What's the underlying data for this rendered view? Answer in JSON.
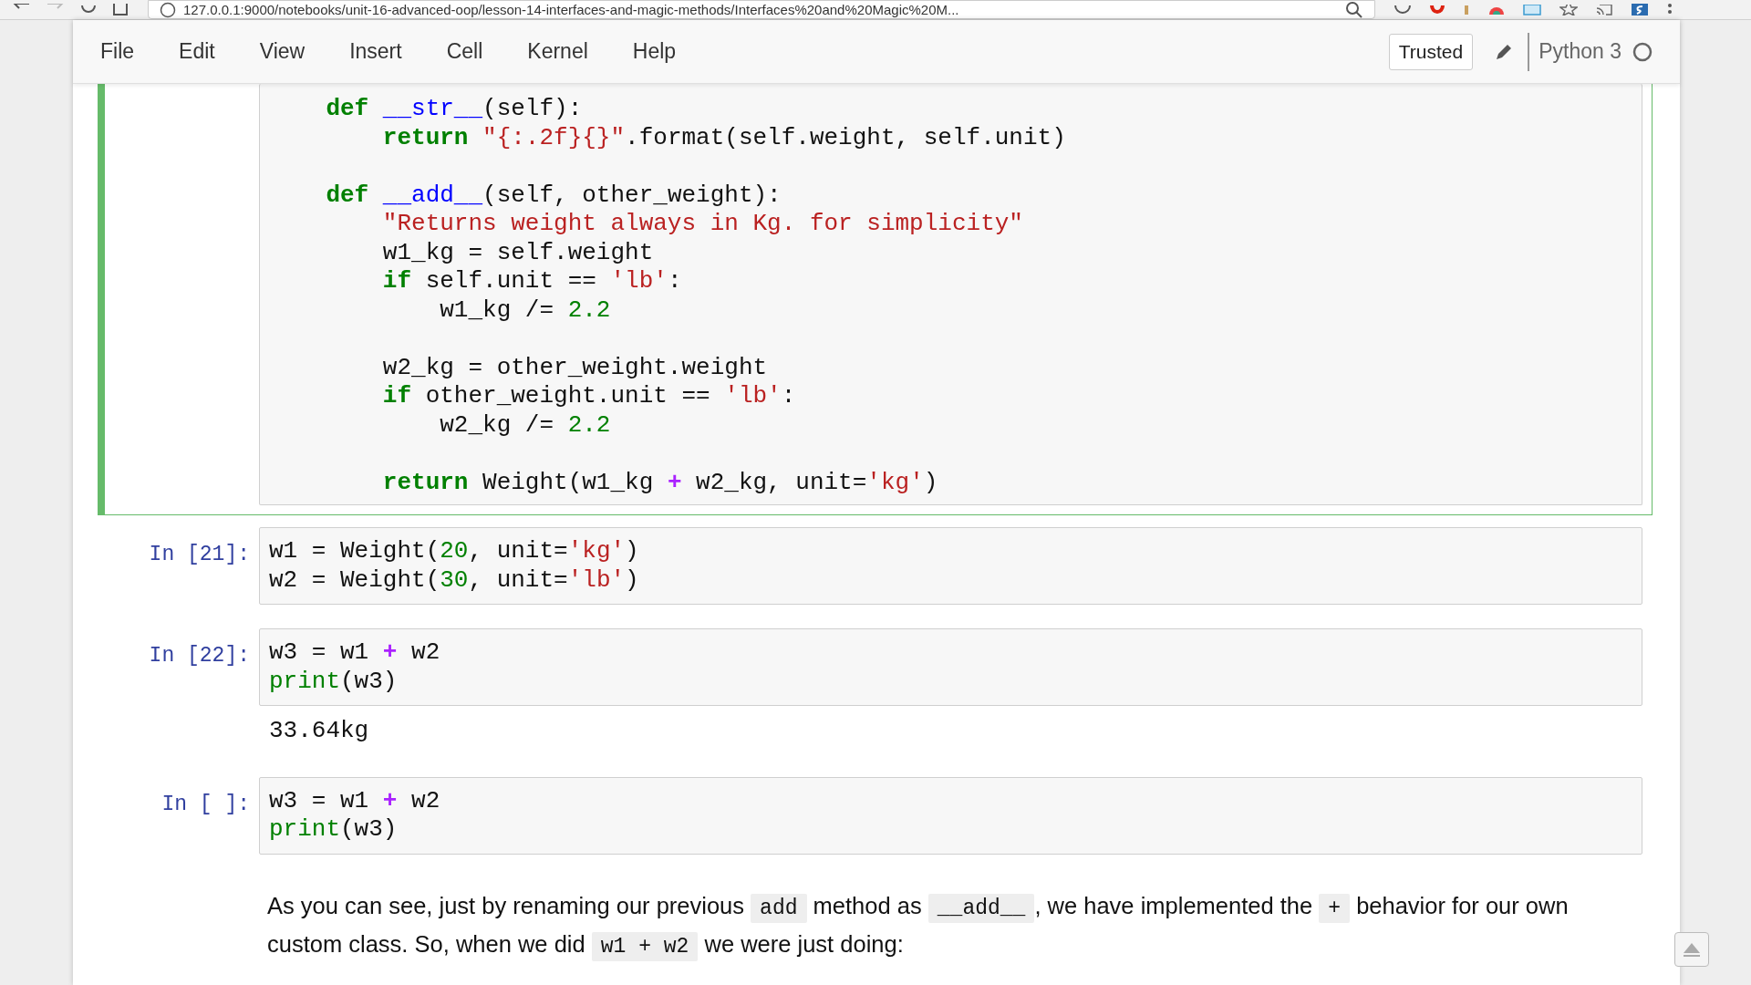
{
  "browser": {
    "url": "127.0.0.1:9000/notebooks/unit-16-advanced-oop/lesson-14-interfaces-and-magic-methods/Interfaces%20and%20Magic%20M..."
  },
  "menu": [
    "File",
    "Edit",
    "View",
    "Insert",
    "Cell",
    "Kernel",
    "Help"
  ],
  "toolbar": {
    "trusted": "Trusted",
    "kernel": "Python 3"
  },
  "cells": [
    {
      "kind": "code",
      "selected": true,
      "lines": [
        {
          "kind": "code",
          "tokens": [
            {
              "text": "    def ",
              "kind": "kw"
            },
            {
              "text": "__str__",
              "kind": "def"
            },
            {
              "text": "(self):"
            }
          ]
        },
        {
          "kind": "code",
          "tokens": [
            {
              "text": "        return ",
              "kind": "kw"
            },
            {
              "text": "\"{:.2f}{}\"",
              "kind": "str"
            },
            {
              "text": ".format(self.weight, self.unit)"
            }
          ]
        },
        {
          "kind": "blank"
        },
        {
          "kind": "code",
          "tokens": [
            {
              "text": "    def ",
              "kind": "kw"
            },
            {
              "text": "__add__",
              "kind": "def"
            },
            {
              "text": "(self, other_weight):"
            }
          ]
        },
        {
          "kind": "code",
          "tokens": [
            {
              "text": "        \"Returns weight always in Kg. for simplicity\"",
              "kind": "str"
            }
          ]
        },
        {
          "kind": "code",
          "tokens": [
            {
              "text": "        w1_kg = self.weight"
            }
          ]
        },
        {
          "kind": "code",
          "tokens": [
            {
              "text": "        if",
              "kind": "kw"
            },
            {
              "text": " self.unit == "
            },
            {
              "text": "'lb'",
              "kind": "str"
            },
            {
              "text": ":"
            }
          ]
        },
        {
          "kind": "code",
          "tokens": [
            {
              "text": "            w1_kg /= "
            },
            {
              "text": "2.2",
              "kind": "num"
            }
          ]
        },
        {
          "kind": "blank"
        },
        {
          "kind": "code",
          "tokens": [
            {
              "text": "        w2_kg = other_weight.weight"
            }
          ]
        },
        {
          "kind": "code",
          "tokens": [
            {
              "text": "        if",
              "kind": "kw"
            },
            {
              "text": " other_weight.unit == "
            },
            {
              "text": "'lb'",
              "kind": "str"
            },
            {
              "text": ":"
            }
          ]
        },
        {
          "kind": "code",
          "tokens": [
            {
              "text": "            w2_kg /= "
            },
            {
              "text": "2.2",
              "kind": "num"
            }
          ]
        },
        {
          "kind": "blank"
        },
        {
          "kind": "code",
          "tokens": [
            {
              "text": "        return",
              "kind": "kw"
            },
            {
              "text": " Weight(w1_kg "
            },
            {
              "text": "+",
              "kind": "op"
            },
            {
              "text": " w2_kg, unit="
            },
            {
              "text": "'kg'",
              "kind": "str"
            },
            {
              "text": ")"
            }
          ]
        }
      ]
    },
    {
      "kind": "code",
      "prompt": "In [21]:",
      "selected": false,
      "lines": [
        {
          "kind": "code",
          "tokens": [
            {
              "text": "w1 = Weight("
            },
            {
              "text": "20",
              "kind": "num"
            },
            {
              "text": ", unit="
            },
            {
              "text": "'kg'",
              "kind": "str"
            },
            {
              "text": ")"
            }
          ]
        },
        {
          "kind": "code",
          "tokens": [
            {
              "text": "w2 = Weight("
            },
            {
              "text": "30",
              "kind": "num"
            },
            {
              "text": ", unit="
            },
            {
              "text": "'lb'",
              "kind": "str"
            },
            {
              "text": ")"
            }
          ]
        }
      ]
    },
    {
      "kind": "code",
      "prompt": "In [22]:",
      "selected": false,
      "lines": [
        {
          "kind": "code",
          "tokens": [
            {
              "text": "w3 = w1 "
            },
            {
              "text": "+",
              "kind": "op"
            },
            {
              "text": " w2"
            }
          ]
        },
        {
          "kind": "code",
          "tokens": [
            {
              "text": "print",
              "kind": "builtin"
            },
            {
              "text": "(w3)"
            }
          ]
        }
      ],
      "output": "33.64kg"
    },
    {
      "kind": "code",
      "prompt": "In [ ]:",
      "selected": false,
      "lines": [
        {
          "kind": "code",
          "tokens": [
            {
              "text": "w3 = w1 "
            },
            {
              "text": "+",
              "kind": "op"
            },
            {
              "text": " w2"
            }
          ]
        },
        {
          "kind": "code",
          "tokens": [
            {
              "text": "print",
              "kind": "builtin"
            },
            {
              "text": "(w3)"
            }
          ]
        }
      ]
    },
    {
      "kind": "markdown",
      "segments": [
        {
          "kind": "text",
          "text": "As you can see, just by renaming our previous "
        },
        {
          "kind": "code",
          "text": "add"
        },
        {
          "kind": "text",
          "text": " method as "
        },
        {
          "kind": "code",
          "text": "__add__"
        },
        {
          "kind": "text",
          "text": ", we have implemented the "
        },
        {
          "kind": "code",
          "text": "+"
        },
        {
          "kind": "text",
          "text": " behavior for our own custom class. So, when we did "
        },
        {
          "kind": "code",
          "text": "w1 + w2"
        },
        {
          "kind": "text",
          "text": " we were just doing:"
        }
      ]
    }
  ]
}
